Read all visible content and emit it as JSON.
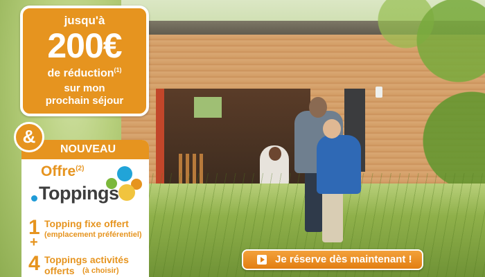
{
  "promo": {
    "lead": "jusqu'à",
    "amount": "200€",
    "reduction": "de réduction",
    "reduction_note": "(1)",
    "stay_line1": "sur mon",
    "stay_line2": "prochain séjour"
  },
  "ampersand": "&",
  "offer": {
    "banner": "NOUVEAU",
    "title": "Offre",
    "title_note": "(2)",
    "brand": "Toppings",
    "rows": [
      {
        "number": "1",
        "main": "Topping fixe offert",
        "sub": "(emplacement préférentiel)"
      },
      {
        "number": "4",
        "main": "Toppings activités",
        "main2": "offerts",
        "sub": "(à choisir)"
      }
    ],
    "plus": "+"
  },
  "cta": {
    "label": "Je réserve dès maintenant !",
    "icon": "arrow-right-icon"
  },
  "colors": {
    "accent": "#e6941f",
    "brand_blue": "#1f9bd7",
    "dark_text": "#3d3d3d"
  }
}
